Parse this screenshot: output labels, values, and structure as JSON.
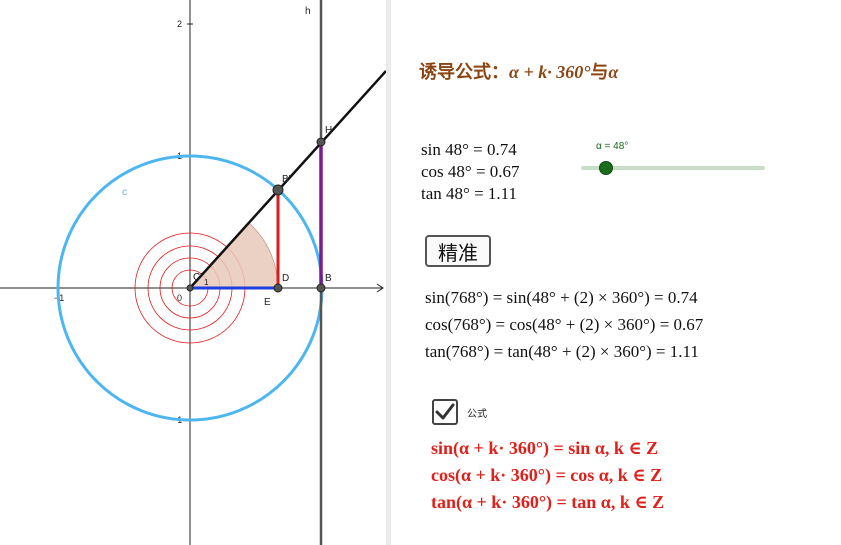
{
  "graph": {
    "axis_ticks": {
      "x_neg1": "−1",
      "x_pos1": "1",
      "y_2": "2",
      "y_1": "1",
      "y_neg1": "−1",
      "origin": "0"
    },
    "point_labels": {
      "h": "h",
      "H": "H",
      "B_prime": "B'",
      "C_prime": "C'",
      "D": "D",
      "E": "E",
      "B": "B",
      "c": "c",
      "one": "1"
    },
    "colors": {
      "circle": "#4db6f0",
      "ray": "#111111",
      "sin_segment": "#e31a1c",
      "cos_segment": "#1f3fe0",
      "tan_segment": "#7b1c8c",
      "arc": "#e31a1c",
      "sector_fill": "#e8c9b8"
    }
  },
  "panel": {
    "title_cn_prefix": "诱导公式：",
    "title_math": "α + k· 360°",
    "title_cn_mid": "与",
    "title_math2": "α",
    "values": {
      "sin": "sin 48° = 0.74",
      "cos": "cos 48° = 0.67",
      "tan": "tan 48° = 1.11"
    },
    "slider": {
      "label": "α = 48°",
      "value_deg": 48,
      "min_deg": 0,
      "max_deg": 360
    },
    "button_label": "精准",
    "equations": {
      "sin": "sin(768°) = sin(48° + (2) × 360°) = 0.74",
      "cos": "cos(768°) = cos(48° + (2) × 360°) = 0.67",
      "tan": "tan(768°) = tan(48° + (2) × 360°) = 1.11"
    },
    "checkbox": {
      "label": "公式",
      "checked": true
    },
    "formulas": {
      "sin": "sin(α + k· 360°) = sin α, k ∈ Z",
      "cos": "cos(α + k· 360°) = cos α, k ∈ Z",
      "tan": "tan(α + k· 360°) = tan α, k ∈ Z"
    }
  }
}
